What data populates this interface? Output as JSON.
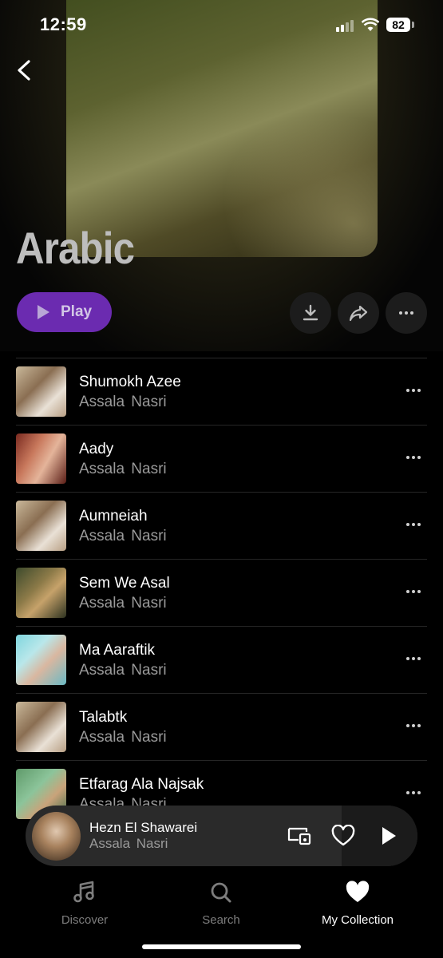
{
  "status_bar": {
    "time": "12:59",
    "battery": "82"
  },
  "page": {
    "title": "Arabic"
  },
  "actions": {
    "play_label": "Play"
  },
  "tracks": [
    {
      "title": "Shumokh Azee",
      "artist": "Assala  Nasri"
    },
    {
      "title": "Aady",
      "artist": "Assala  Nasri"
    },
    {
      "title": "Aumneiah",
      "artist": "Assala  Nasri"
    },
    {
      "title": "Sem We Asal",
      "artist": "Assala  Nasri"
    },
    {
      "title": "Ma Aaraftik",
      "artist": "Assala  Nasri"
    },
    {
      "title": "Talabtk",
      "artist": "Assala  Nasri"
    },
    {
      "title": "Etfarag Ala Najsak",
      "artist": "Assala  Nasri"
    }
  ],
  "now_playing": {
    "title": "Hezn El Shawarei",
    "artist": "Assala  Nasri"
  },
  "tabs": [
    {
      "label": "Discover",
      "icon": "music-note-icon"
    },
    {
      "label": "Search",
      "icon": "search-icon"
    },
    {
      "label": "My Collection",
      "icon": "heart-icon"
    }
  ],
  "colors": {
    "accent": "#6b2bb0",
    "background": "#000000"
  }
}
